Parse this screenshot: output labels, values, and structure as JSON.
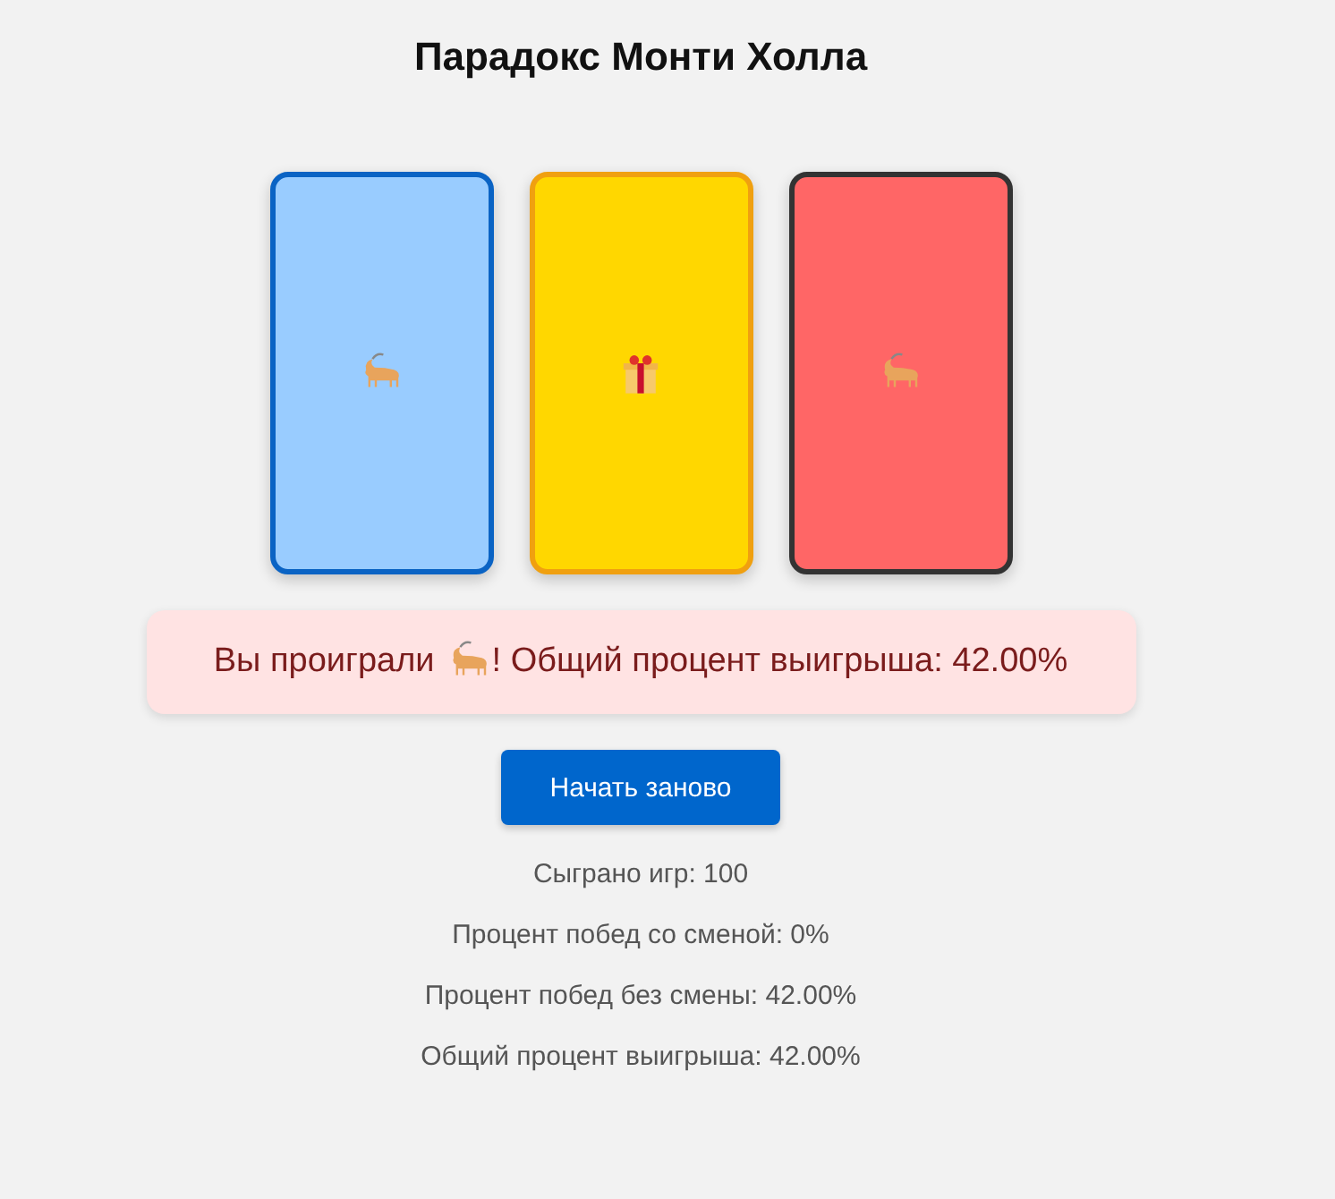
{
  "title": "Парадокс Монти Холла",
  "doors": [
    {
      "kind": "goat",
      "color": "#99ccff"
    },
    {
      "kind": "gift",
      "color": "#ffd700"
    },
    {
      "kind": "goat",
      "color": "#ff6666"
    }
  ],
  "message": {
    "kind": "lose",
    "before": "Вы проиграли",
    "after": "! Общий процент выигрыша: 42.00%"
  },
  "restart_button": "Начать заново",
  "stats": [
    "Сыграно игр: 100",
    "Процент побед со сменой: 0%",
    "Процент побед без смены: 42.00%",
    "Общий процент выигрыша: 42.00%"
  ]
}
